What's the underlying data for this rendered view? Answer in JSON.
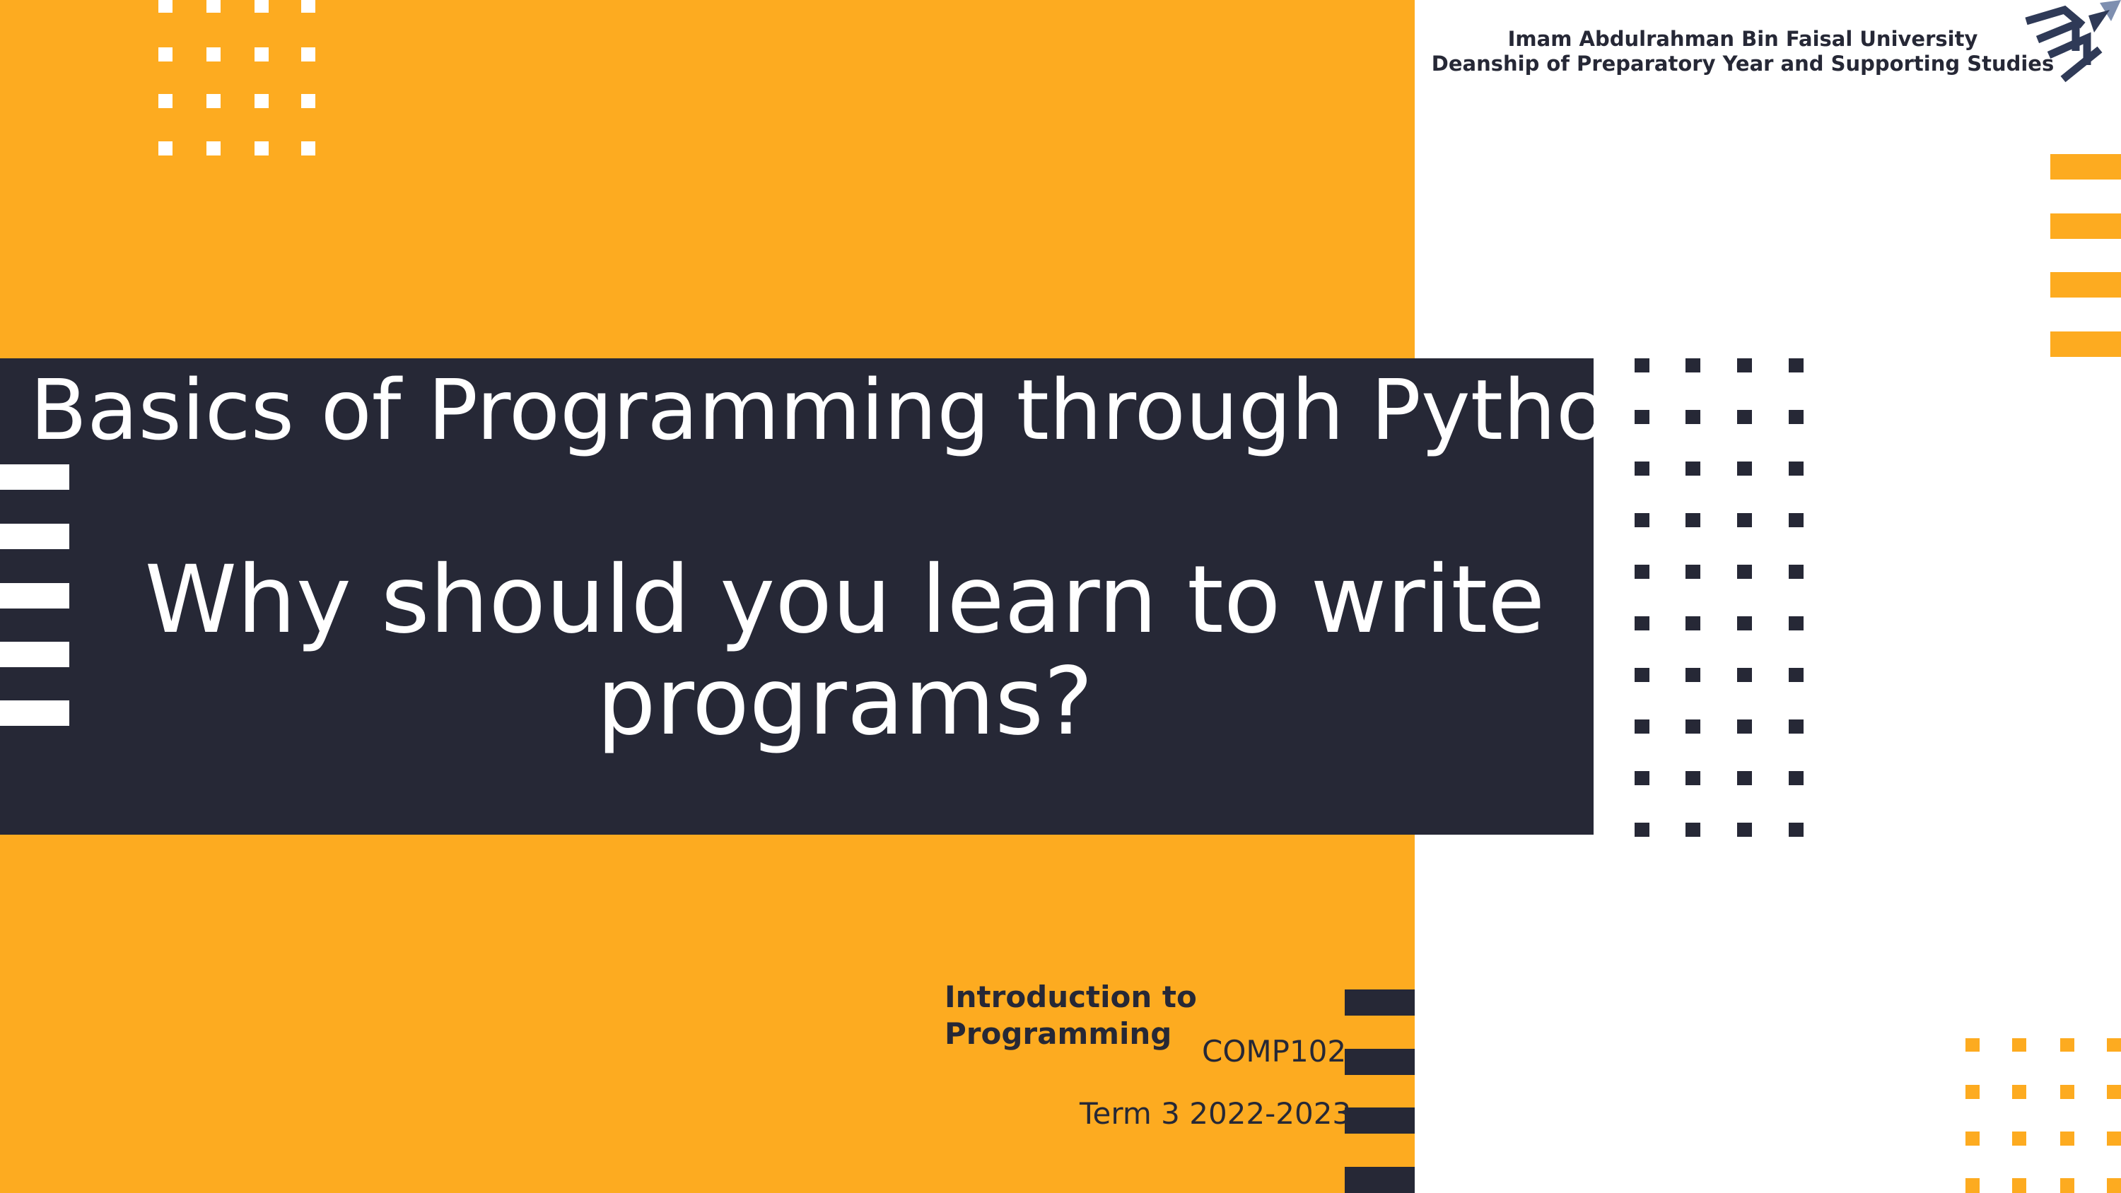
{
  "header": {
    "university": "Imam Abdulrahman Bin Faisal University",
    "deanship": "Deanship of Preparatory Year and Supporting Studies"
  },
  "title": {
    "line1": "Basics of Programming through Python",
    "line2": "Why should you learn to write programs?"
  },
  "course": {
    "name": "Introduction to Programming",
    "code": "COMP102",
    "term": "Term 3 2022-2023"
  },
  "colors": {
    "orange": "#FDAB20",
    "dark": "#262836",
    "white": "#FFFFFF",
    "logo": "#2F3A57"
  },
  "icons": {
    "logo": "university-logo-icon"
  }
}
